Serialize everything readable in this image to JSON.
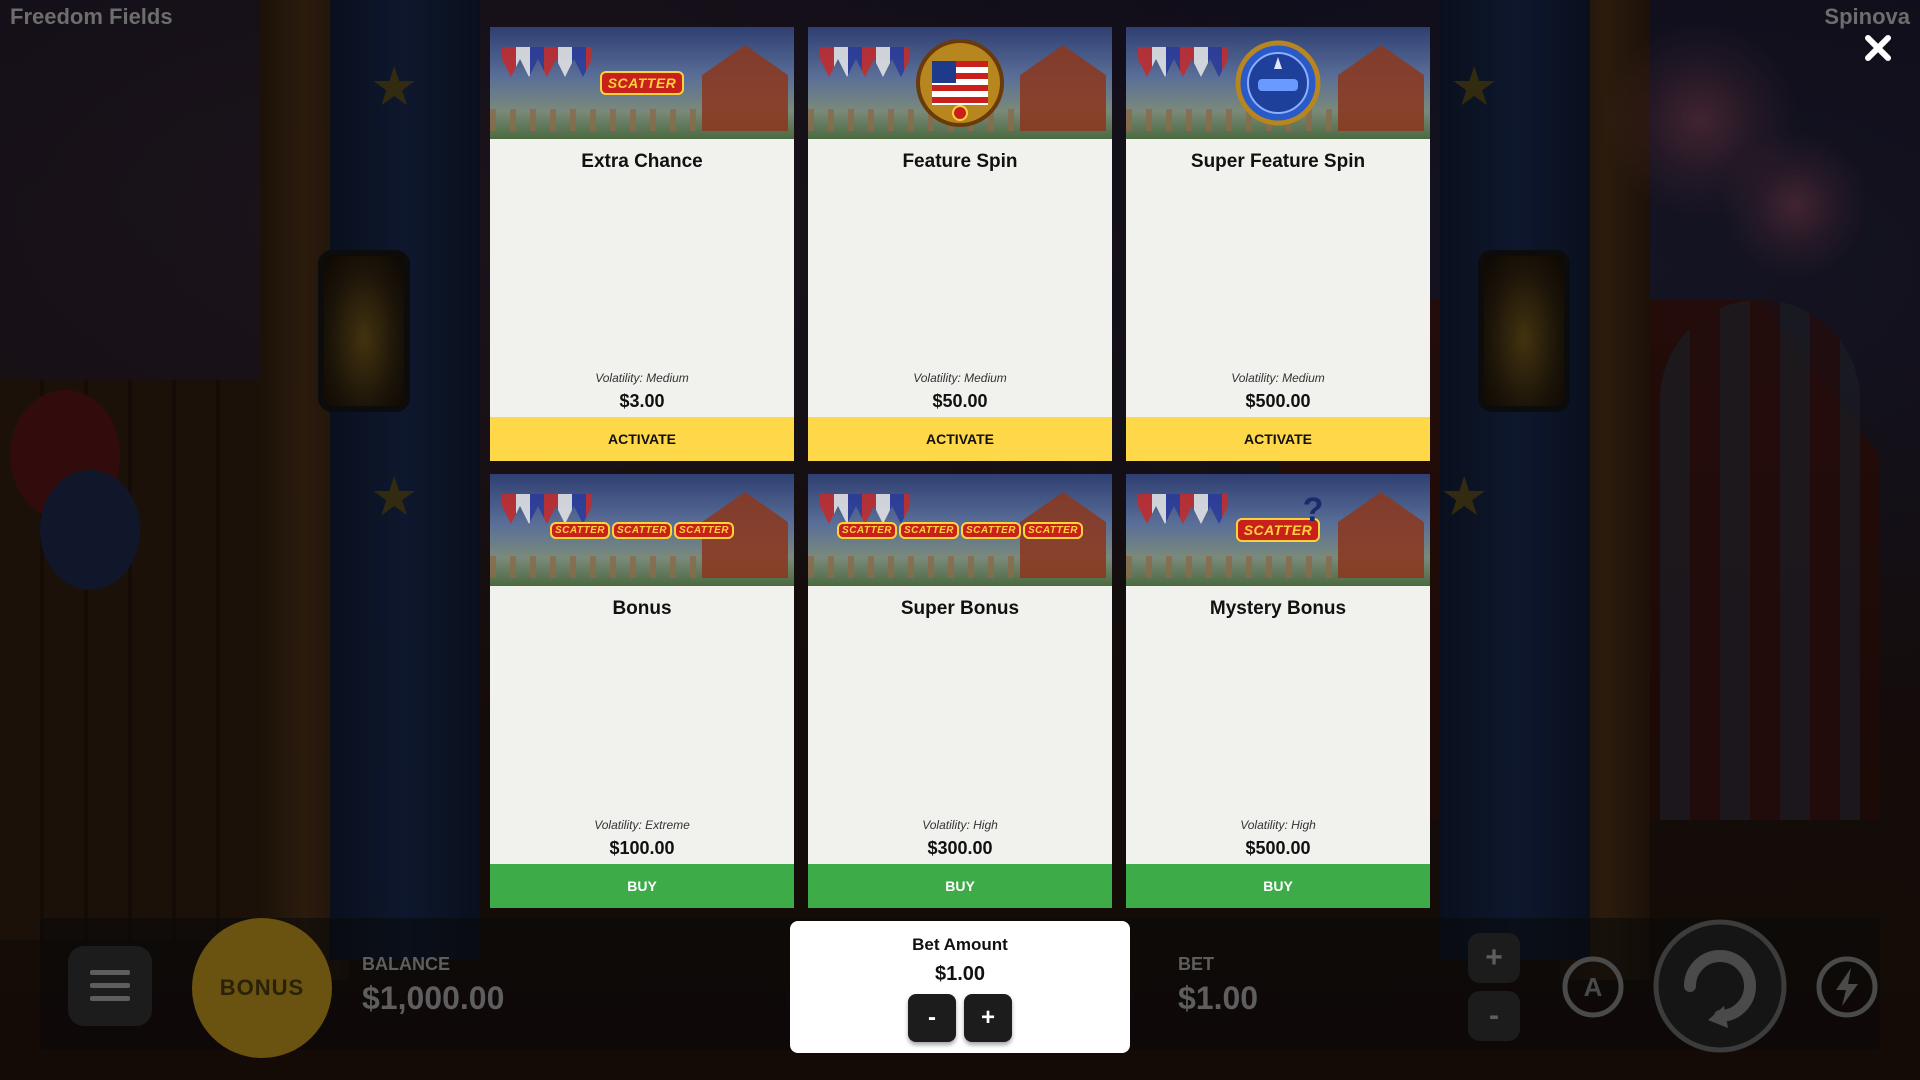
{
  "game": {
    "title": "Freedom Fields",
    "brand": "Spinova"
  },
  "close": {
    "icon": "close-x-icon"
  },
  "hud": {
    "bonus_label": "BONUS",
    "balance_label": "BALANCE",
    "balance_value": "$1,000.00",
    "bet_label": "BET",
    "bet_value": "$1.00",
    "plus": "+",
    "minus": "-"
  },
  "features": [
    {
      "title": "Extra Chance",
      "volatility": "Volatility: Medium",
      "price": "$3.00",
      "action": "ACTIVATE",
      "icon": "scatter-rocket-icon",
      "badge": "SCATTER"
    },
    {
      "title": "Feature Spin",
      "volatility": "Volatility: Medium",
      "price": "$50.00",
      "action": "ACTIVATE",
      "icon": "american-flag-badge-icon"
    },
    {
      "title": "Super Feature Spin",
      "volatility": "Volatility: Medium",
      "price": "$500.00",
      "action": "ACTIVATE",
      "icon": "blue-statue-badge-icon"
    },
    {
      "title": "Bonus",
      "volatility": "Volatility: Extreme",
      "price": "$100.00",
      "action": "BUY",
      "icon": "three-scatters-icon",
      "badge": "SCATTER"
    },
    {
      "title": "Super Bonus",
      "volatility": "Volatility: High",
      "price": "$300.00",
      "action": "BUY",
      "icon": "four-scatters-icon",
      "badge": "SCATTER"
    },
    {
      "title": "Mystery Bonus",
      "volatility": "Volatility: High",
      "price": "$500.00",
      "action": "BUY",
      "icon": "mystery-scatter-icon",
      "badge": "SCATTER"
    }
  ],
  "bet_panel": {
    "title": "Bet Amount",
    "amount": "$1.00",
    "minus": "-",
    "plus": "+"
  },
  "colors": {
    "activate": "#ffd84a",
    "buy": "#3dab48",
    "card": "#f1f1ee"
  }
}
